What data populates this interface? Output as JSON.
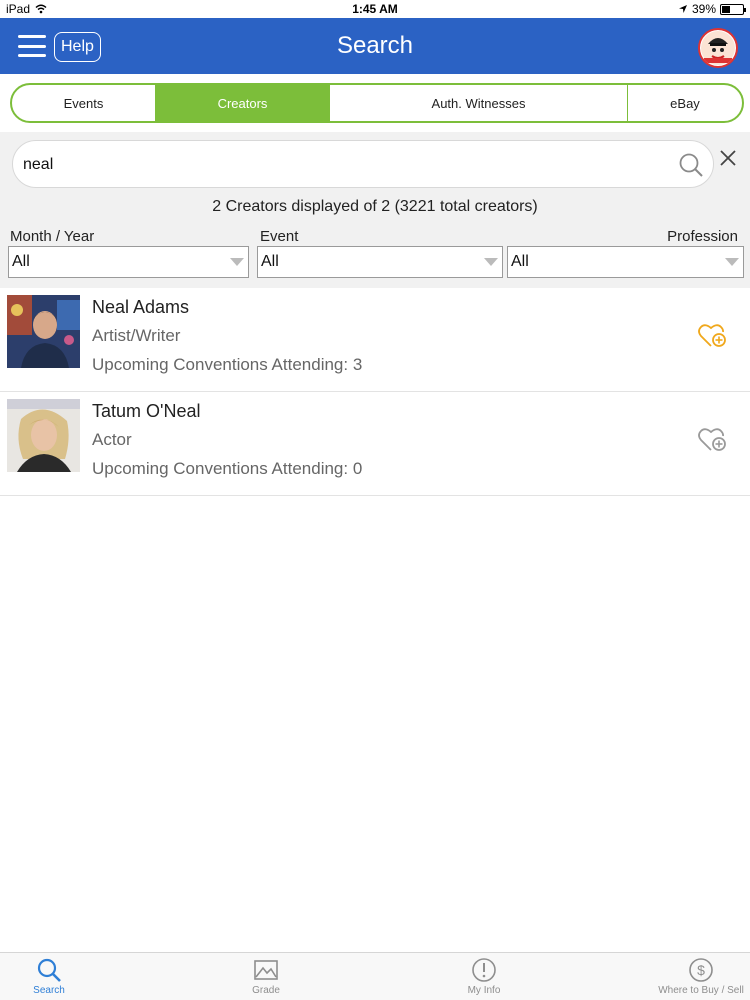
{
  "status_bar": {
    "device": "iPad",
    "time": "1:45 AM",
    "battery": "39%",
    "battery_level": 0.39
  },
  "header": {
    "help_label": "Help",
    "title": "Search",
    "brand_color": "#2b62c4"
  },
  "tabs": [
    {
      "label": "Events",
      "active": false
    },
    {
      "label": "Creators",
      "active": true
    },
    {
      "label": "Auth. Witnesses",
      "active": false
    },
    {
      "label": "eBay",
      "active": false
    }
  ],
  "accent_color": "#7cbe3a",
  "search": {
    "value": "neal",
    "count_text": "2 Creators displayed of 2 (3221 total creators)"
  },
  "filters": [
    {
      "label": "Month / Year",
      "value": "All"
    },
    {
      "label": "Event",
      "value": "All"
    },
    {
      "label": "Profession",
      "value": "All"
    }
  ],
  "results": [
    {
      "name": "Neal Adams",
      "profession": "Artist/Writer",
      "conventions": "Upcoming Conventions Attending: 3",
      "favorite_icon": "heart-plus-icon",
      "favorite_color": "#f0a81c"
    },
    {
      "name": "Tatum O'Neal",
      "profession": "Actor",
      "conventions": "Upcoming Conventions Attending: 0",
      "favorite_icon": "heart-plus-icon",
      "favorite_color": "#9a9a9a"
    }
  ],
  "bottom_tabs": [
    {
      "label": "Search",
      "icon": "magnifier-icon",
      "active": true
    },
    {
      "label": "Grade",
      "icon": "image-icon",
      "active": false
    },
    {
      "label": "My Info",
      "icon": "exclamation-circle-icon",
      "active": false
    },
    {
      "label": "Where to Buy / Sell",
      "icon": "dollar-circle-icon",
      "active": false
    }
  ]
}
